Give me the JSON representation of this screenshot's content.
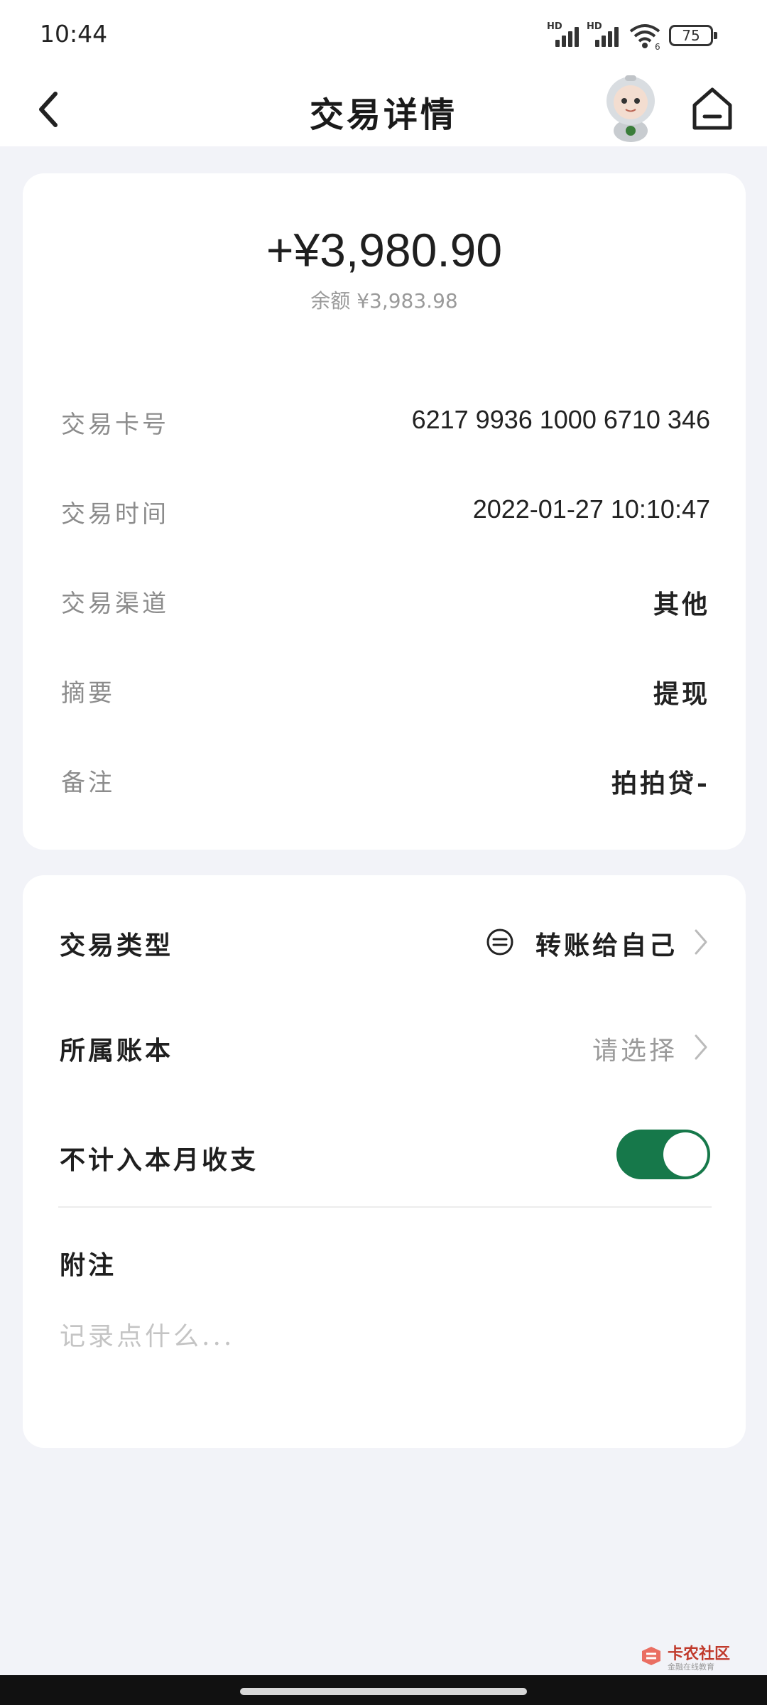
{
  "status_bar": {
    "time": "10:44",
    "signal_label_1": "HD",
    "signal_label_2": "HD",
    "wifi_sub": "6",
    "battery": "75"
  },
  "header": {
    "title": "交易详情",
    "back_icon": "chevron-left-icon",
    "home_icon": "home-icon",
    "mascot": "astronaut-mascot"
  },
  "summary": {
    "amount": "+¥3,980.90",
    "balance": "余额 ¥3,983.98"
  },
  "details": [
    {
      "label": "交易卡号",
      "value": "6217 9936 1000 6710 346"
    },
    {
      "label": "交易时间",
      "value": "2022-01-27 10:10:47"
    },
    {
      "label": "交易渠道",
      "value": "其他"
    },
    {
      "label": "摘要",
      "value": "提现"
    },
    {
      "label": "备注",
      "value": "拍拍贷-"
    }
  ],
  "settings": {
    "type_label": "交易类型",
    "type_value": "转账给自己",
    "type_icon": "transfer-icon",
    "ledger_label": "所属账本",
    "ledger_value": "请选择",
    "exclude_label": "不计入本月收支",
    "exclude_enabled": true,
    "note_label": "附注",
    "note_placeholder": "记录点什么..."
  },
  "watermark": {
    "title": "卡农社区",
    "subtitle": "金融在线教育"
  },
  "colors": {
    "toggle_on": "#16784a",
    "background": "#f2f3f8"
  }
}
